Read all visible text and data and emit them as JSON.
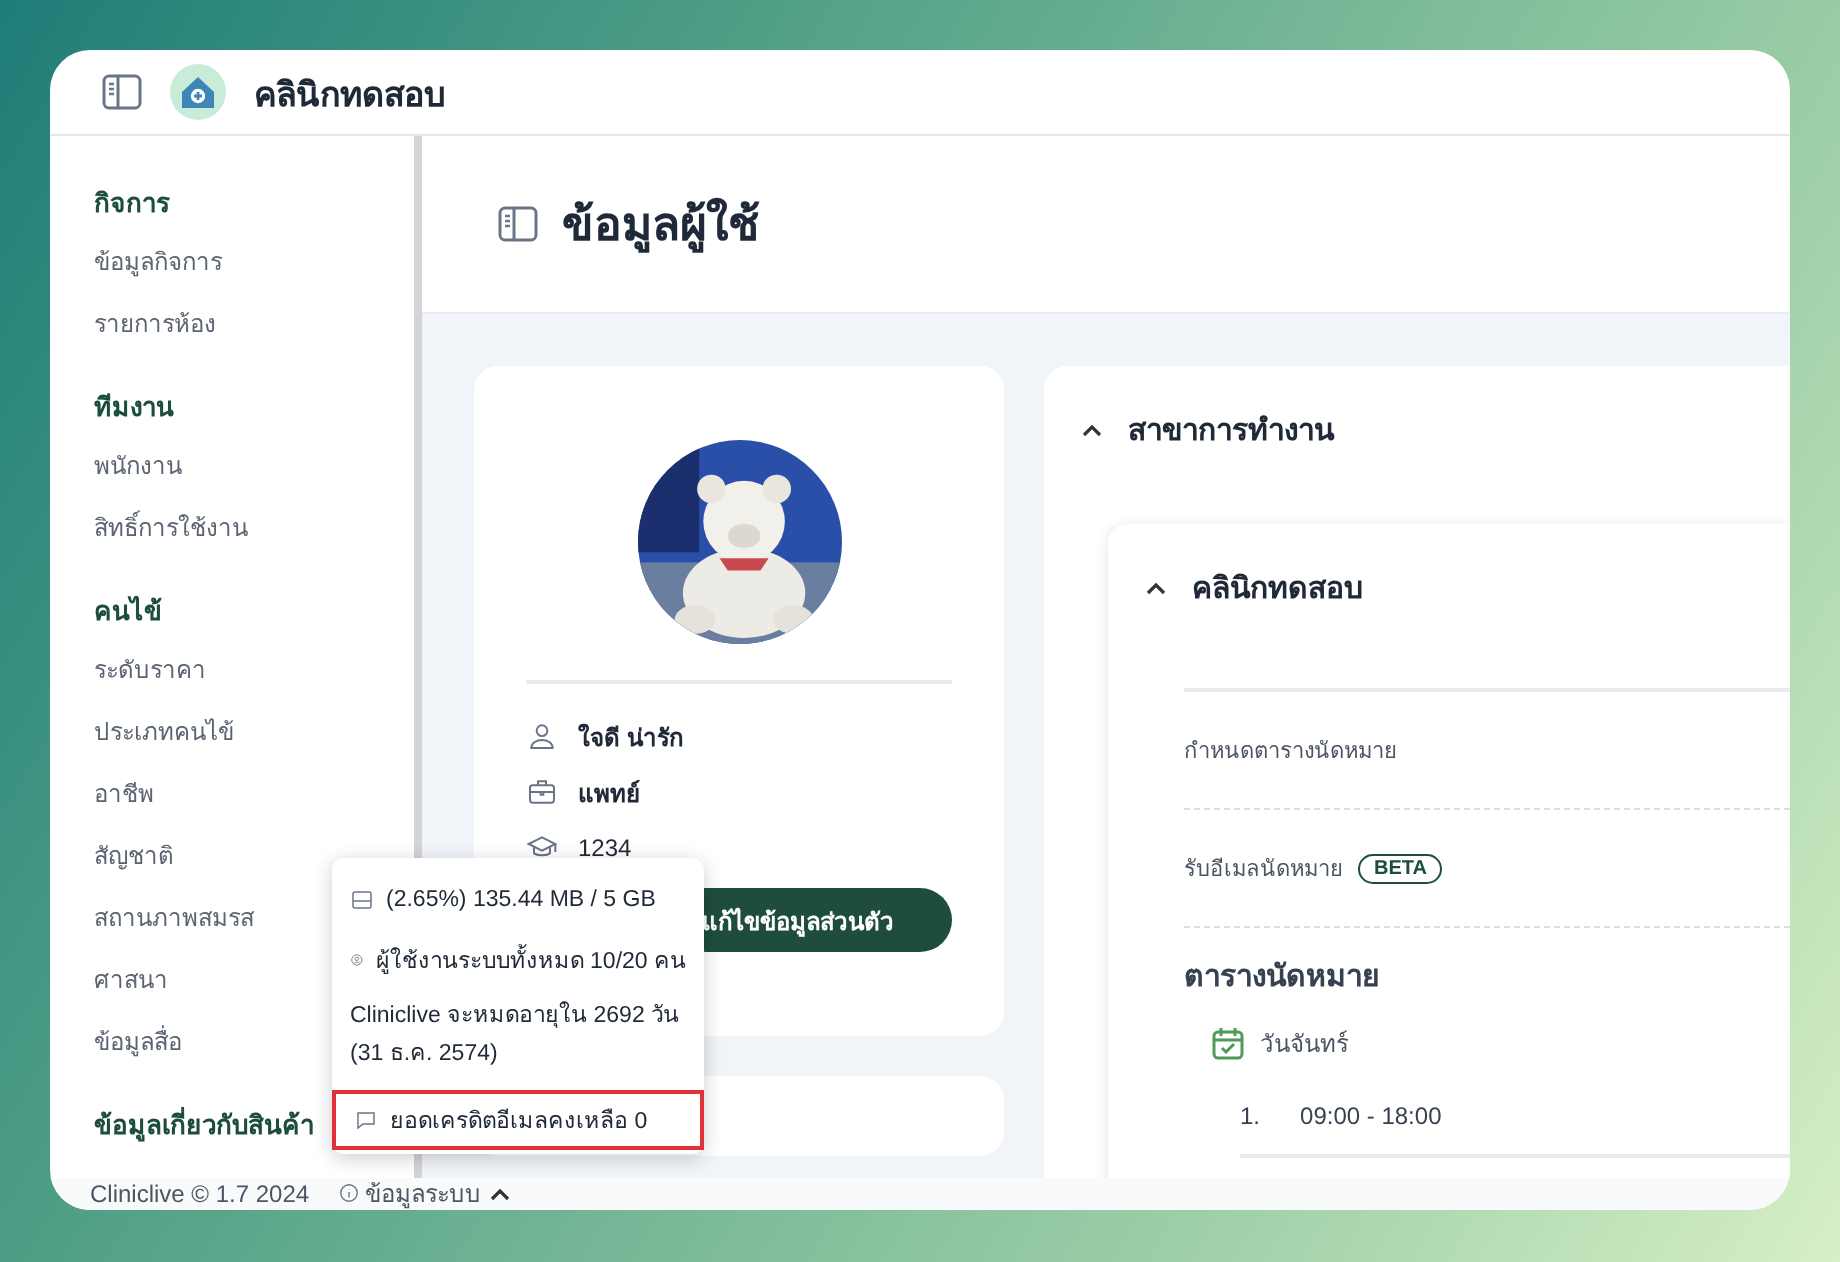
{
  "header": {
    "title": "คลินิกทดสอบ"
  },
  "sidebar": {
    "groups": [
      {
        "heading": "กิจการ",
        "items": [
          "ข้อมูลกิจการ",
          "รายการห้อง"
        ]
      },
      {
        "heading": "ทีมงาน",
        "items": [
          "พนักงาน",
          "สิทธิ์การใช้งาน"
        ]
      },
      {
        "heading": "คนไข้",
        "items": [
          "ระดับราคา",
          "ประเภทคนไข้",
          "อาชีพ",
          "สัญชาติ",
          "สถานภาพสมรส",
          "ศาสนา",
          "ข้อมูลสื่อ"
        ]
      },
      {
        "heading": "ข้อมูลเกี่ยวกับสินค้า"
      }
    ]
  },
  "page_title": "ข้อมูลผู้ใช้",
  "profile": {
    "name": "ใจดี น่ารัก",
    "role": "แพทย์",
    "code": "1234",
    "edit_button": "แก้ไขข้อมูลส่วนตัว"
  },
  "branches": {
    "title": "สาขาการทำงาน",
    "expanded": true,
    "clinic": {
      "name": "คลินิกทดสอบ",
      "expanded": true,
      "settings": [
        {
          "label": "กำหนดตารางนัดหมาย"
        },
        {
          "label": "รับอีเมลนัดหมาย",
          "badge": "BETA"
        }
      ],
      "schedule": {
        "title": "ตารางนัดหมาย",
        "days": [
          {
            "day": "วันจันทร์",
            "slots": [
              {
                "number": "1.",
                "time": "09:00 - 18:00"
              }
            ]
          }
        ]
      }
    }
  },
  "popup": {
    "storage": "(2.65%) 135.44 MB / 5 GB",
    "users": "ผู้ใช้งานระบบทั้งหมด 10/20 คน",
    "expiry": "Cliniclive จะหมดอายุใน 2692 วัน (31 ธ.ค. 2574)",
    "email_credit": "ยอดเครดิตอีเมลคงเหลือ 0",
    "email_credit_highlighted": true
  },
  "footer": {
    "copyright": "Cliniclive © 1.7 2024",
    "system_info": "ข้อมูลระบบ",
    "system_info_expanded": true
  }
}
